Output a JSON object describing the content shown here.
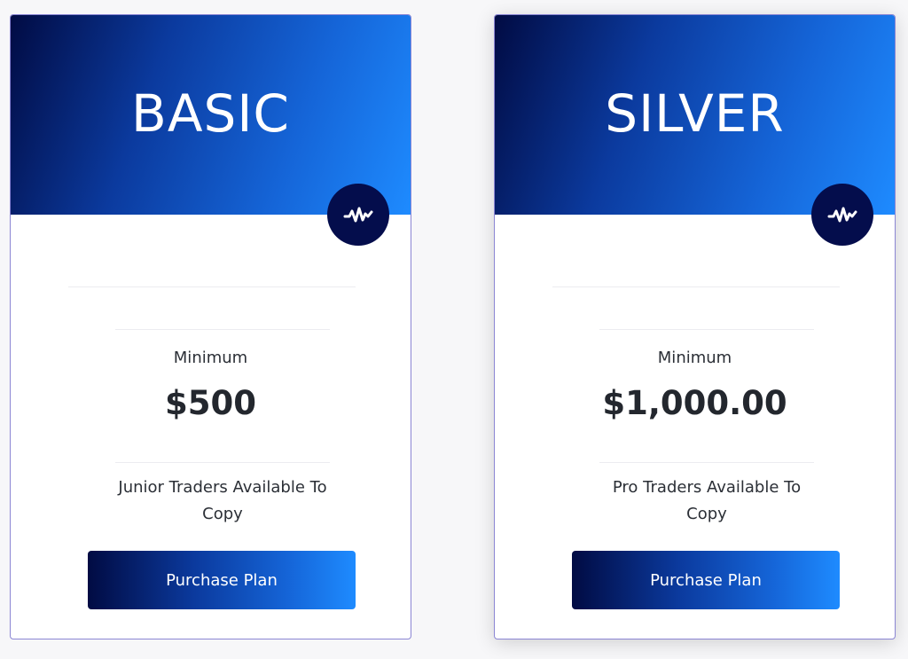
{
  "colors": {
    "gradient_start": "#010b43",
    "gradient_end": "#1e8bff",
    "icon_bg": "#040d4c",
    "card_border": "#8b86d4"
  },
  "plans": [
    {
      "name": "BASIC",
      "icon": "activity-pulse-icon",
      "minimum_label": "Minimum",
      "minimum_value": "$500",
      "description": "Junior Traders Available To Copy",
      "button_label": "Purchase Plan"
    },
    {
      "name": "SILVER",
      "icon": "activity-pulse-icon",
      "minimum_label": "Minimum",
      "minimum_value": "$1,000.00",
      "description": "Pro Traders Available To Copy",
      "button_label": "Purchase Plan"
    }
  ]
}
